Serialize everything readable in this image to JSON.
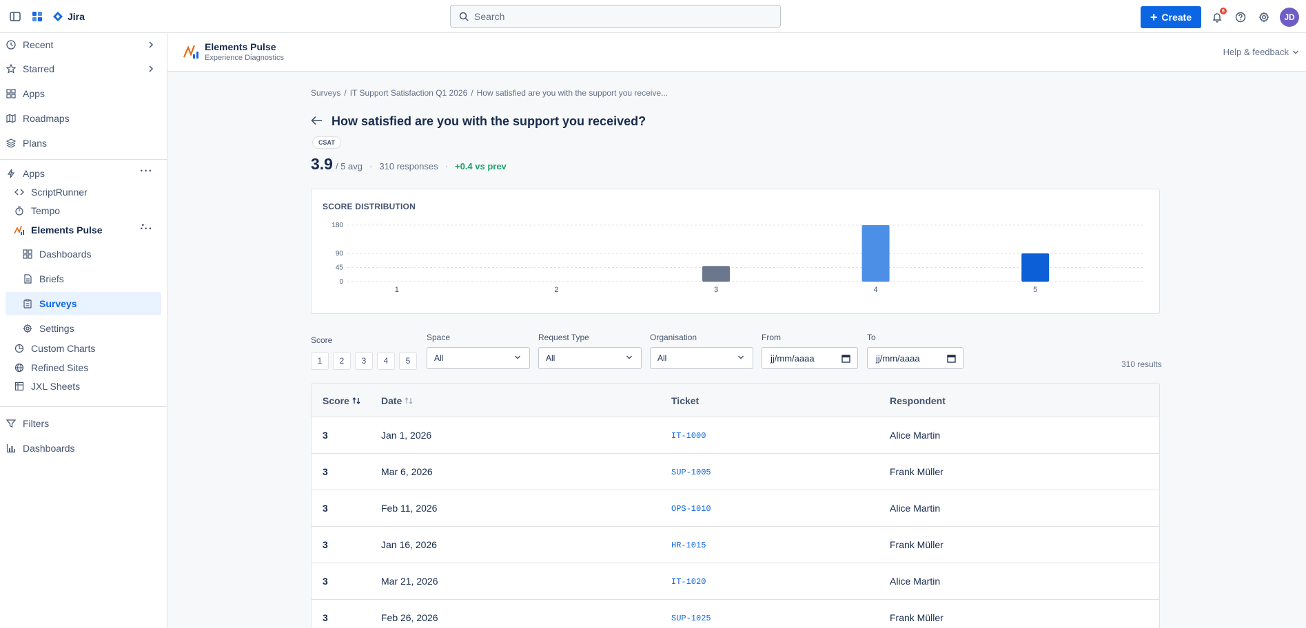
{
  "topbar": {
    "product": "Jira",
    "search_placeholder": "Search",
    "create_label": "Create",
    "notif_count": "6",
    "avatar_initials": "JD"
  },
  "sidebar": {
    "items": [
      {
        "label": "Recent"
      },
      {
        "label": "Starred"
      },
      {
        "label": "Apps"
      },
      {
        "label": "Roadmaps"
      },
      {
        "label": "Plans"
      },
      {
        "label": "Apps"
      },
      {
        "label": "ScriptRunner"
      },
      {
        "label": "Tempo"
      },
      {
        "label": "Elements Pulse"
      },
      {
        "label": "Dashboards"
      },
      {
        "label": "Briefs"
      },
      {
        "label": "Surveys"
      },
      {
        "label": "Settings"
      },
      {
        "label": "Custom Charts"
      },
      {
        "label": "Refined Sites"
      },
      {
        "label": "JXL Sheets"
      },
      {
        "label": "Filters"
      },
      {
        "label": "Dashboards"
      }
    ]
  },
  "app": {
    "name": "Elements Pulse",
    "subtitle": "Experience Diagnostics",
    "help_label": "Help & feedback"
  },
  "breadcrumb": {
    "items": [
      "Surveys",
      "IT Support Satisfaction Q1 2026",
      "How satisfied are you with the support you receive..."
    ]
  },
  "question": {
    "title": "How satisfied are you with the support you received?",
    "badge": "CSAT",
    "avg": "3.9",
    "avg_suffix": "/ 5 avg",
    "responses": "310 responses",
    "delta": "+0.4 vs prev"
  },
  "chart_data": {
    "type": "bar",
    "title": "SCORE DISTRIBUTION",
    "categories": [
      "1",
      "2",
      "3",
      "4",
      "5"
    ],
    "values": [
      0,
      0,
      50,
      180,
      90
    ],
    "y_ticks": [
      "0",
      "45",
      "90",
      "180"
    ],
    "ylim": [
      0,
      180
    ],
    "colors": [
      "#6b778c",
      "#6b778c",
      "#6b778c",
      "#4c8fe6",
      "#0c5fd6"
    ],
    "grid": true
  },
  "filters": {
    "score_label": "Score",
    "score_options": [
      "1",
      "2",
      "3",
      "4",
      "5"
    ],
    "space_label": "Space",
    "space_value": "All",
    "request_type_label": "Request Type",
    "request_type_value": "All",
    "organisation_label": "Organisation",
    "organisation_value": "All",
    "from_label": "From",
    "from_value": "jj/mm/aaaa",
    "to_label": "To",
    "to_value": "jj/mm/aaaa",
    "results": "310 results"
  },
  "table": {
    "headers": [
      "Score",
      "Date",
      "Ticket",
      "Respondent"
    ],
    "rows": [
      {
        "score": "3",
        "date": "Jan 1, 2026",
        "ticket": "IT-1000",
        "respondent": "Alice Martin"
      },
      {
        "score": "3",
        "date": "Mar 6, 2026",
        "ticket": "SUP-1005",
        "respondent": "Frank Müller"
      },
      {
        "score": "3",
        "date": "Feb 11, 2026",
        "ticket": "OPS-1010",
        "respondent": "Alice Martin"
      },
      {
        "score": "3",
        "date": "Jan 16, 2026",
        "ticket": "HR-1015",
        "respondent": "Frank Müller"
      },
      {
        "score": "3",
        "date": "Mar 21, 2026",
        "ticket": "IT-1020",
        "respondent": "Alice Martin"
      },
      {
        "score": "3",
        "date": "Feb 26, 2026",
        "ticket": "SUP-1025",
        "respondent": "Frank Müller"
      }
    ]
  }
}
